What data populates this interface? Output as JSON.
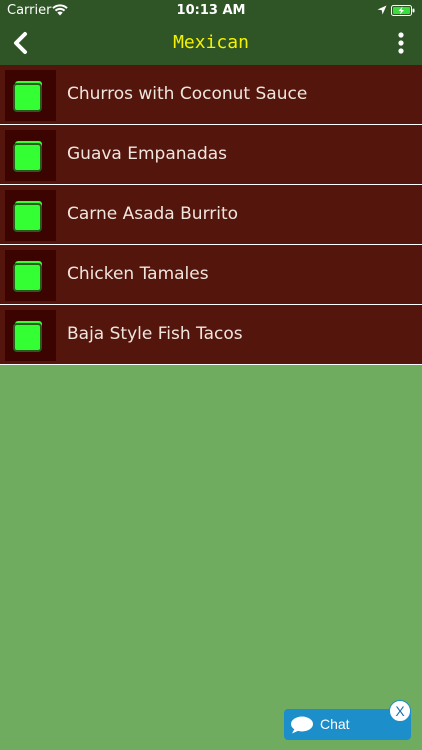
{
  "status_bar": {
    "carrier": "Carrier",
    "time": "10:13 AM"
  },
  "nav": {
    "title": "Mexican",
    "back_icon": "chevron-left-icon",
    "more_icon": "more-vertical-icon"
  },
  "recipes": [
    {
      "label": "Churros with Coconut Sauce"
    },
    {
      "label": "Guava Empanadas"
    },
    {
      "label": "Carne Asada Burrito"
    },
    {
      "label": "Chicken Tamales"
    },
    {
      "label": "Baja Style Fish Tacos"
    }
  ],
  "chat": {
    "label": "Chat",
    "close_label": "X"
  },
  "colors": {
    "header": "#2f5527",
    "title": "#f4f200",
    "row": "#54150c",
    "thumb": "#3c0400",
    "icon": "#33ff33",
    "background": "#6fac5f",
    "chat": "#1c8ec9"
  }
}
